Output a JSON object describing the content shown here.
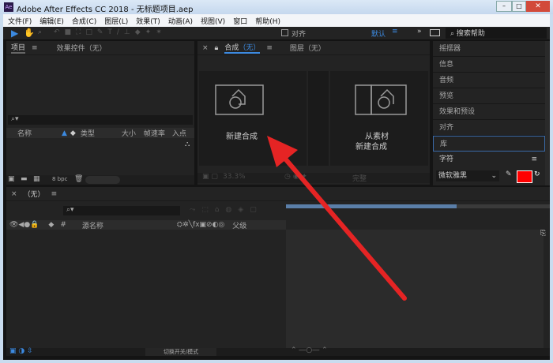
{
  "window": {
    "title": "Adobe After Effects CC 2018 - 无标题项目.aep",
    "app_icon": "Ae"
  },
  "menu": [
    "文件(F)",
    "编辑(E)",
    "合成(C)",
    "图层(L)",
    "效果(T)",
    "动画(A)",
    "视图(V)",
    "窗口",
    "帮助(H)"
  ],
  "toolbar": {
    "snap_label": "对齐",
    "workspace": "默认",
    "search_placeholder": "搜索帮助"
  },
  "project": {
    "tab": "项目",
    "effects_tab": "效果控件（无）",
    "columns": [
      "名称",
      "类型",
      "大小",
      "帧速率",
      "入点"
    ],
    "bpc": "8 bpc"
  },
  "comp": {
    "tab": "合成",
    "tab_value": "（无）",
    "layer_tab": "图层（无）",
    "new_comp": "新建合成",
    "from_footage_1": "从素材",
    "from_footage_2": "新建合成",
    "zoom": "33.3%",
    "view": "完整"
  },
  "right_panel": {
    "items": [
      "摇摆器",
      "信息",
      "音频",
      "预览",
      "效果和预设",
      "对齐",
      "库",
      "字符"
    ],
    "font": "微软雅黑",
    "fill_color": "#ff0000"
  },
  "timeline": {
    "tab": "（无）",
    "columns": [
      "#",
      "源名称",
      "父级"
    ],
    "toggle_label": "切换开关/模式"
  },
  "annotation": {
    "arrow_color": "#e52424"
  }
}
